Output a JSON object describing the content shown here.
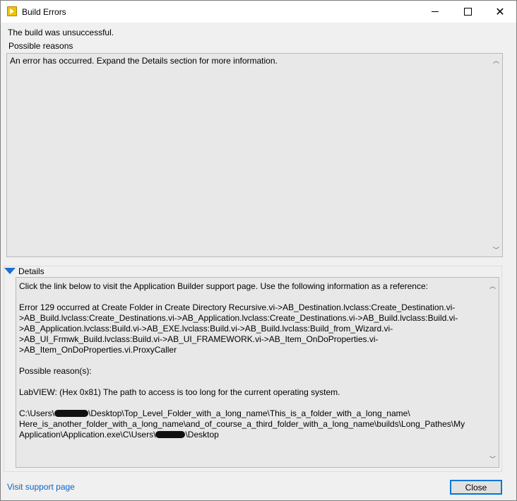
{
  "window": {
    "title": "Build Errors",
    "icon": "labview-icon"
  },
  "summary": {
    "status_text": "The build was unsuccessful.",
    "possible_reasons_label": "Possible reasons",
    "reasons_text": "An error has occurred. Expand the Details section for more information."
  },
  "details": {
    "label": "Details",
    "lines": [
      "Click the link below to visit the Application Builder support page. Use the following information as a reference:",
      "",
      "Error 129 occurred at Create Folder in Create Directory Recursive.vi->AB_Destination.lvclass:Create_Destination.vi-",
      ">AB_Build.lvclass:Create_Destinations.vi->AB_Application.lvclass:Create_Destinations.vi->AB_Build.lvclass:Build.vi-",
      ">AB_Application.lvclass:Build.vi->AB_EXE.lvclass:Build.vi->AB_Build.lvclass:Build_from_Wizard.vi-",
      ">AB_UI_Frmwk_Build.lvclass:Build.vi->AB_UI_FRAMEWORK.vi->AB_Item_OnDoProperties.vi-",
      ">AB_Item_OnDoProperties.vi.ProxyCaller",
      "",
      "Possible reason(s):",
      "",
      "LabVIEW: (Hex 0x81) The path to access is too long for the current operating system.",
      ""
    ],
    "path_line_1_prefix": "C:\\Users\\",
    "path_line_1_suffix": "\\Desktop\\Top_Level_Folder_with_a_long_name\\This_is_a_folder_with_a_long_name\\",
    "path_line_2": "Here_is_another_folder_with_a_long_name\\and_of_course_a_third_folder_with_a_long_name\\builds\\Long_Pathes\\My",
    "path_line_3_prefix": "Application\\Application.exe\\C\\Users\\",
    "path_line_3_suffix": "\\Desktop"
  },
  "footer": {
    "support_link": "Visit support page",
    "close_label": "Close"
  },
  "colors": {
    "link": "#0b64c6",
    "expander": "#1f6fd1",
    "focus_border": "#0078d7"
  }
}
